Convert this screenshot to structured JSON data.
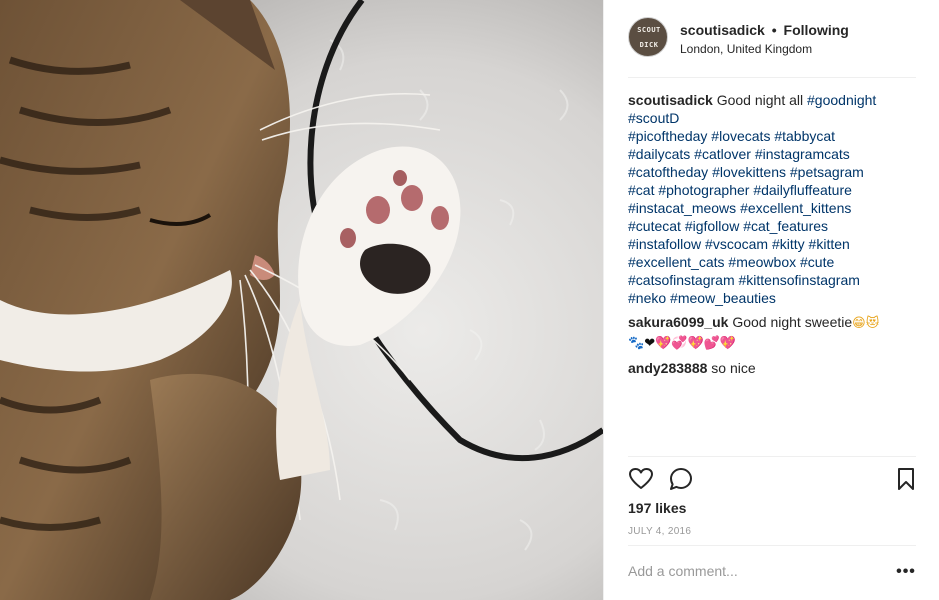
{
  "post": {
    "author": "scoutisadick",
    "follow_status": "Following",
    "separator": "•",
    "location": "London, United Kingdom",
    "avatar_text": [
      "SCOUT",
      "DICK"
    ]
  },
  "caption": {
    "username": "scoutisadick",
    "text": "Good night all",
    "hashtag_lines": [
      [
        "#goodnight"
      ],
      [
        "#scoutD"
      ],
      [
        "#picoftheday",
        "#lovecats",
        "#tabbycat"
      ],
      [
        "#dailycats",
        "#catlover",
        "#instagramcats"
      ],
      [
        "#catoftheday",
        "#lovekittens",
        "#petsagram"
      ],
      [
        "#cat",
        "#photographer",
        "#dailyfluffeature"
      ],
      [
        "#instacat_meows",
        "#excellent_kittens"
      ],
      [
        "#cutecat",
        "#igfollow",
        "#cat_features"
      ],
      [
        "#instafollow",
        "#vscocam",
        "#kitty",
        "#kitten"
      ],
      [
        "#excellent_cats",
        "#meowbox",
        "#cute"
      ],
      [
        "#catsofinstagram",
        "#kittensofinstagram"
      ],
      [
        "#neko",
        "#meow_beauties"
      ]
    ]
  },
  "comments": [
    {
      "username": "sakura6099_uk",
      "text": "Good night sweetie",
      "emoji": [
        "😁",
        "😻",
        "🐾",
        "❤",
        "💖",
        "💞",
        "💖",
        "💕",
        "💖"
      ]
    },
    {
      "username": "andy283888",
      "text": "so nice"
    }
  ],
  "actions": {
    "icons": [
      "heart-icon",
      "comment-icon",
      "bookmark-icon"
    ]
  },
  "likes": "197 likes",
  "date": "JULY 4, 2016",
  "add_comment": {
    "placeholder": "Add a comment...",
    "more": "•••"
  },
  "colors": {
    "hashtag": "#003569",
    "text": "#262626",
    "muted": "#999999",
    "divider": "#efefef"
  }
}
